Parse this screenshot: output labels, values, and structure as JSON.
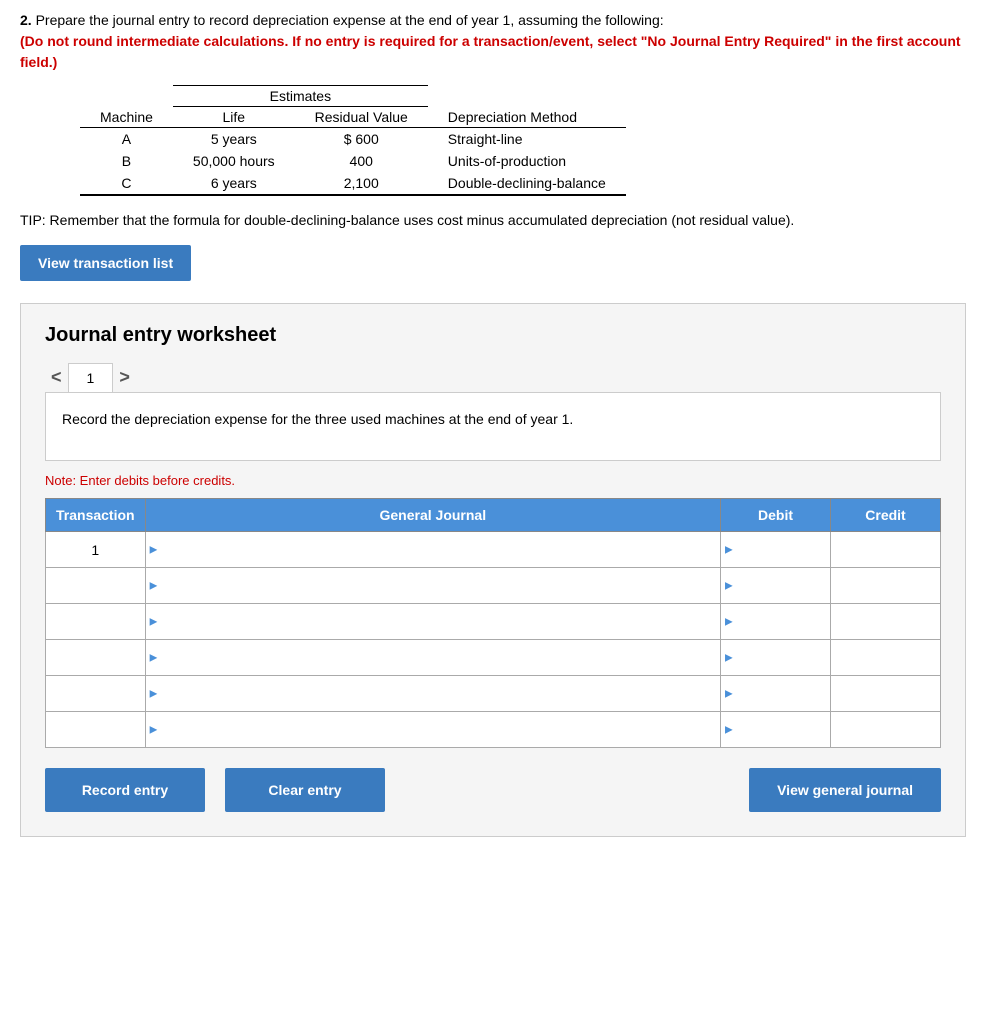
{
  "question": {
    "number": "2.",
    "text": "Prepare the journal entry to record depreciation expense at the end of year 1, assuming the following:",
    "instruction": "(Do not round intermediate calculations. If no entry is required for a transaction/event, select \"No Journal Entry Required\" in the first account field.)"
  },
  "estimates_table": {
    "title": "Estimates",
    "headers": [
      "Machine",
      "Life",
      "Residual Value",
      "Depreciation Method"
    ],
    "rows": [
      {
        "machine": "A",
        "life": "5 years",
        "residual": "$ 600",
        "method": "Straight-line"
      },
      {
        "machine": "B",
        "life": "50,000 hours",
        "residual": "400",
        "method": "Units-of-production"
      },
      {
        "machine": "C",
        "life": "6 years",
        "residual": "2,100",
        "method": "Double-declining-balance"
      }
    ]
  },
  "tip_text": "TIP: Remember that the formula for double-declining-balance uses cost minus accumulated depreciation (not residual value).",
  "view_transaction_btn": "View transaction list",
  "worksheet": {
    "title": "Journal entry worksheet",
    "tab_prev": "<",
    "tab_next": ">",
    "tab_number": "1",
    "description": "Record the depreciation expense for the three used machines at the end of year 1.",
    "note": "Note: Enter debits before credits.",
    "table_headers": {
      "transaction": "Transaction",
      "general_journal": "General Journal",
      "debit": "Debit",
      "credit": "Credit"
    },
    "rows": [
      {
        "transaction": "1",
        "gj": "",
        "debit": "",
        "credit": ""
      },
      {
        "transaction": "",
        "gj": "",
        "debit": "",
        "credit": ""
      },
      {
        "transaction": "",
        "gj": "",
        "debit": "",
        "credit": ""
      },
      {
        "transaction": "",
        "gj": "",
        "debit": "",
        "credit": ""
      },
      {
        "transaction": "",
        "gj": "",
        "debit": "",
        "credit": ""
      },
      {
        "transaction": "",
        "gj": "",
        "debit": "",
        "credit": ""
      }
    ]
  },
  "buttons": {
    "record_entry": "Record entry",
    "clear_entry": "Clear entry",
    "view_general_journal": "View general journal"
  }
}
